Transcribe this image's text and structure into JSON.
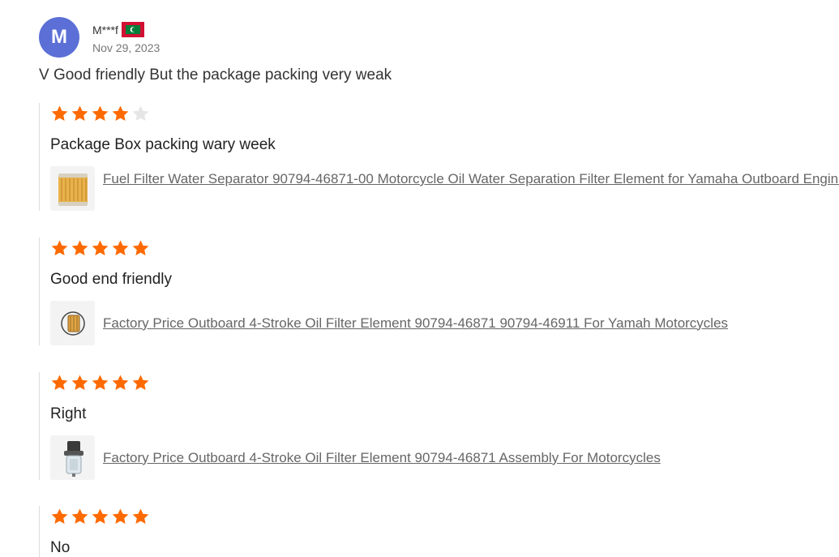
{
  "review": {
    "avatar_letter": "M",
    "username": "M***f",
    "country_flag": "maldives-flag",
    "date": "Nov 29, 2023",
    "text": "V Good friendly But the package packing very weak"
  },
  "colors": {
    "avatar_bg": "#5b6fd6",
    "star_filled": "#ff6a00",
    "star_empty": "#e6e6e6",
    "link_text": "#666666"
  },
  "items": [
    {
      "rating": 4,
      "max_rating": 5,
      "text": "Package Box packing wary week",
      "product_icon": "fuel-filter-cartridge-icon",
      "product_title": "Fuel Filter Water Separator 90794-46871-00 Motorcycle Oil Water Separation Filter Element for Yamaha Outboard Engine"
    },
    {
      "rating": 5,
      "max_rating": 5,
      "text": "Good end friendly",
      "product_icon": "oil-filter-element-icon",
      "product_title": "Factory Price Outboard 4-Stroke Oil Filter Element 90794-46871 90794-46911 For Yamah Motorcycles"
    },
    {
      "rating": 5,
      "max_rating": 5,
      "text": "Right",
      "product_icon": "filter-assembly-icon",
      "product_title": "Factory Price Outboard 4-Stroke Oil Filter Element 90794-46871 Assembly For Motorcycles"
    },
    {
      "rating": 5,
      "max_rating": 5,
      "text": "No"
    }
  ]
}
